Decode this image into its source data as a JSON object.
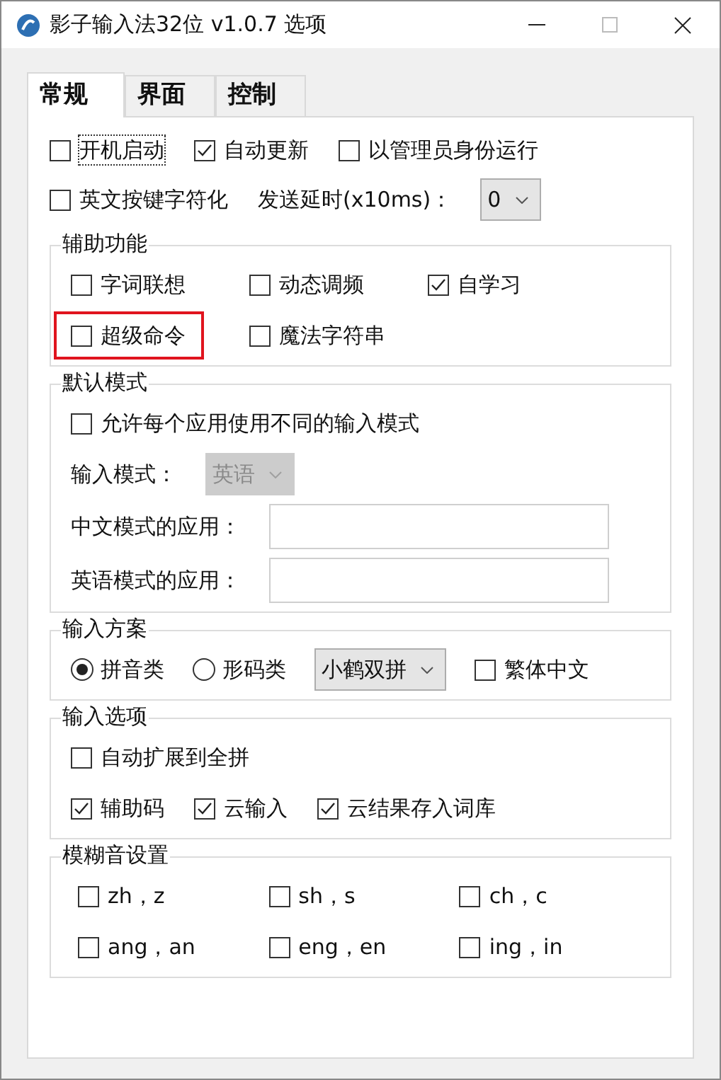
{
  "window": {
    "title": "影子输入法32位 v1.0.7 选项"
  },
  "tabs": [
    {
      "label": "常规",
      "selected": true
    },
    {
      "label": "界面",
      "selected": false
    },
    {
      "label": "控制",
      "selected": false
    }
  ],
  "top_rows": [
    [
      {
        "kind": "checkbox",
        "label": "开机启动",
        "checked": false,
        "focused": true
      },
      {
        "kind": "checkbox",
        "label": "自动更新",
        "checked": true
      },
      {
        "kind": "checkbox",
        "label": "以管理员身份运行",
        "checked": false
      }
    ],
    [
      {
        "kind": "checkbox",
        "label": "英文按键字符化",
        "checked": false
      },
      {
        "kind": "label",
        "text": "发送延时(x10ms)："
      },
      {
        "kind": "select",
        "value": "0",
        "disabled": false
      }
    ]
  ],
  "sections": [
    {
      "title": "辅助功能",
      "kind": "grid",
      "rows": [
        [
          {
            "kind": "checkbox",
            "label": "字词联想",
            "checked": false
          },
          {
            "kind": "checkbox",
            "label": "动态调频",
            "checked": false
          },
          {
            "kind": "checkbox",
            "label": "自学习",
            "checked": true
          }
        ],
        [
          {
            "kind": "checkbox",
            "label": "超级命令",
            "checked": false,
            "highlighted": true
          },
          {
            "kind": "checkbox",
            "label": "魔法字符串",
            "checked": false
          }
        ]
      ]
    },
    {
      "title": "默认模式",
      "kind": "flow",
      "rows": [
        [
          {
            "kind": "checkbox",
            "label": "允许每个应用使用不同的输入模式",
            "checked": false
          }
        ],
        [
          {
            "kind": "label",
            "text": "输入模式："
          },
          {
            "kind": "select",
            "value": "英语",
            "disabled": true
          }
        ],
        [
          {
            "kind": "label",
            "text": "中文模式的应用："
          },
          {
            "kind": "field"
          }
        ],
        [
          {
            "kind": "label",
            "text": "英语模式的应用："
          },
          {
            "kind": "field"
          }
        ]
      ]
    },
    {
      "title": "输入方案",
      "kind": "flow",
      "rows": [
        [
          {
            "kind": "radio",
            "label": "拼音类",
            "selected": true
          },
          {
            "kind": "radio",
            "label": "形码类",
            "selected": false
          },
          {
            "kind": "select",
            "value": "小鹤双拼",
            "disabled": false
          },
          {
            "kind": "checkbox",
            "label": "繁体中文",
            "checked": false
          }
        ]
      ]
    },
    {
      "title": "输入选项",
      "kind": "flow",
      "rows": [
        [
          {
            "kind": "checkbox",
            "label": "自动扩展到全拼",
            "checked": false
          }
        ],
        [
          {
            "kind": "checkbox",
            "label": "辅助码",
            "checked": true
          },
          {
            "kind": "checkbox",
            "label": "云输入",
            "checked": true
          },
          {
            "kind": "checkbox",
            "label": "云结果存入词库",
            "checked": true
          }
        ]
      ]
    },
    {
      "title": "模糊音设置",
      "kind": "wide_grid",
      "rows": [
        [
          {
            "kind": "checkbox",
            "label": "zh，z",
            "checked": false
          },
          {
            "kind": "checkbox",
            "label": "sh，s",
            "checked": false
          },
          {
            "kind": "checkbox",
            "label": "ch，c",
            "checked": false
          }
        ],
        [
          {
            "kind": "checkbox",
            "label": "ang，an",
            "checked": false
          },
          {
            "kind": "checkbox",
            "label": "eng，en",
            "checked": false
          },
          {
            "kind": "checkbox",
            "label": "ing，in",
            "checked": false
          }
        ]
      ]
    }
  ]
}
